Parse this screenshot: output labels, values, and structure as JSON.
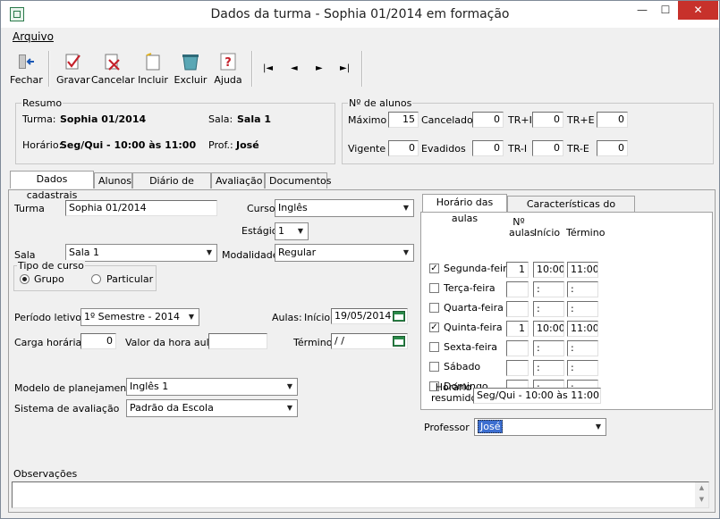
{
  "window": {
    "title": "Dados da turma - Sophia 01/2014 em formação"
  },
  "menu": {
    "arquivo": "Arquivo"
  },
  "toolbar": {
    "fechar": "Fechar",
    "gravar": "Gravar",
    "cancelar": "Cancelar",
    "incluir": "Incluir",
    "excluir": "Excluir",
    "ajuda": "Ajuda",
    "first": "|◄",
    "prev": "◄",
    "next": "►",
    "last": "►|"
  },
  "resumo": {
    "title": "Resumo",
    "turma_label": "Turma:",
    "turma": "Sophia 01/2014",
    "sala_label": "Sala:",
    "sala": "Sala 1",
    "horario_label": "Horário:",
    "horario": "Seg/Qui - 10:00 às 11:00",
    "prof_label": "Prof.:",
    "prof": "José"
  },
  "alunos": {
    "title": "Nº de alunos",
    "maximo_label": "Máximo",
    "maximo": "15",
    "cancelados_label": "Cancelados",
    "cancelados": "0",
    "tri_label": "TR+I",
    "tri": "0",
    "tre_label": "TR+E",
    "tre": "0",
    "vigente_label": "Vigente",
    "vigente": "0",
    "evadidos_label": "Evadidos",
    "evadidos": "0",
    "trmi_label": "TR-I",
    "trmi": "0",
    "trme_label": "TR-E",
    "trme": "0"
  },
  "tabs": [
    "Dados cadastrais",
    "Alunos",
    "Diário de classe",
    "Avaliação",
    "Documentos"
  ],
  "form": {
    "turma_label": "Turma",
    "turma": "Sophia 01/2014",
    "curso_label": "Curso",
    "curso": "Inglês",
    "estagio_label": "Estágio",
    "estagio": "1",
    "sala_label": "Sala",
    "sala": "Sala 1",
    "modalidade_label": "Modalidade",
    "modalidade": "Regular",
    "tipo_title": "Tipo de curso",
    "grupo": "Grupo",
    "particular": "Particular",
    "periodo_label": "Período letivo",
    "periodo": "1º Semestre - 2014",
    "aulas_label": "Aulas:",
    "inicio_label": "Início",
    "inicio": "19/05/2014",
    "carga_label": "Carga horária",
    "carga": "0",
    "valor_label": "Valor da hora aula",
    "valor": "",
    "termino_label": "Término",
    "termino": "/ /",
    "modelo_label": "Modelo de planejamento",
    "modelo": "Inglês 1",
    "sistema_label": "Sistema de avaliação",
    "sistema": "Padrão da Escola",
    "obs_label": "Observações",
    "obs": ""
  },
  "horario": {
    "tab1": "Horário das aulas",
    "tab2": "Características do professor",
    "col_naulas": "Nº aulas",
    "col_inicio": "Início",
    "col_termino": "Término",
    "days": [
      {
        "name": "Segunda-feira",
        "checked": true,
        "n": "1",
        "ini": "10:00",
        "fim": "11:00"
      },
      {
        "name": "Terça-feira",
        "checked": false,
        "n": "",
        "ini": ":",
        "fim": ":"
      },
      {
        "name": "Quarta-feira",
        "checked": false,
        "n": "",
        "ini": ":",
        "fim": ":"
      },
      {
        "name": "Quinta-feira",
        "checked": true,
        "n": "1",
        "ini": "10:00",
        "fim": "11:00"
      },
      {
        "name": "Sexta-feira",
        "checked": false,
        "n": "",
        "ini": ":",
        "fim": ":"
      },
      {
        "name": "Sábado",
        "checked": false,
        "n": "",
        "ini": ":",
        "fim": ":"
      },
      {
        "name": "Domingo",
        "checked": false,
        "n": "",
        "ini": ":",
        "fim": ":"
      }
    ],
    "resumido_label": "Horário resumido",
    "resumido": "Seg/Qui - 10:00 às 11:00",
    "professor_label": "Professor",
    "professor": "José"
  }
}
